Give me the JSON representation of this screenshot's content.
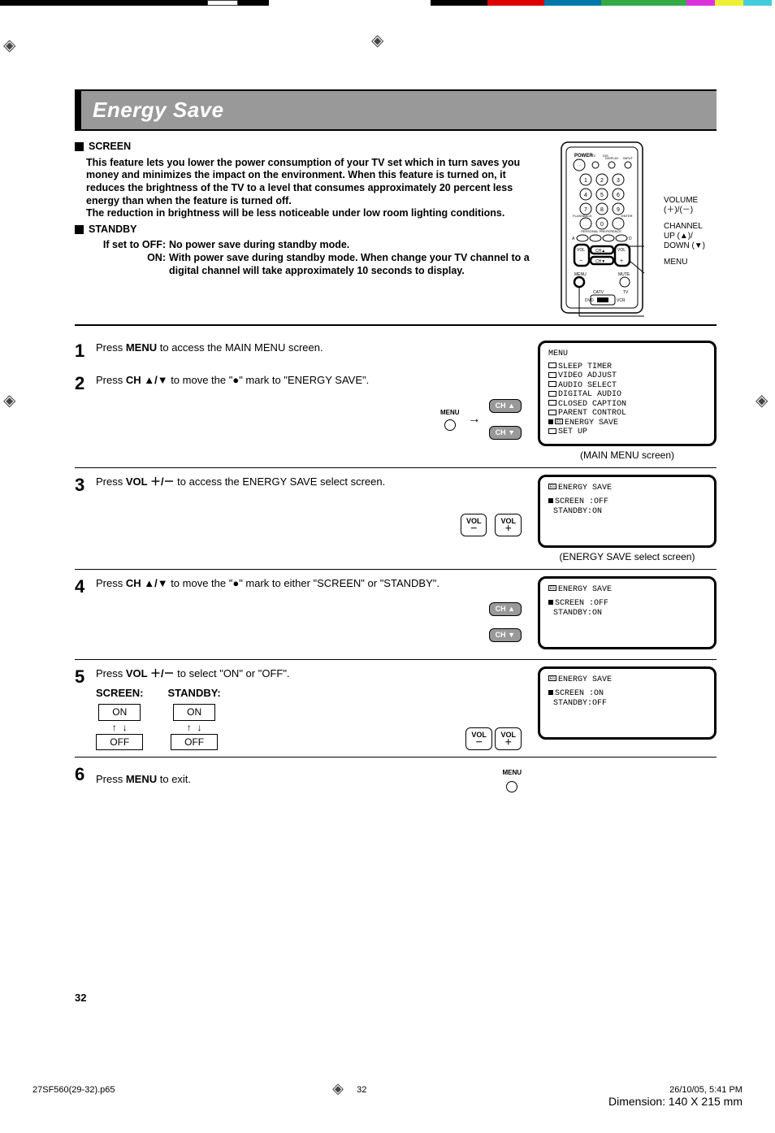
{
  "title": "Energy Save",
  "screen_head": "SCREEN",
  "screen_body": "This feature lets you lower the power consumption of your TV set which in turn saves you money and minimizes the impact on the environment. When this feature is turned on, it reduces the brightness of the TV to a level that consumes approximately 20 percent less energy than when the feature is turned off.\nThe reduction in brightness will be less noticeable under low room lighting conditions.",
  "standby_head": "STANDBY",
  "standby_off": "If set to OFF:",
  "standby_off_body": "No power save during standby mode.",
  "standby_on": "ON:",
  "standby_on_body": "With power save during standby mode. When change your TV channel to a digital channel will take approximately 10 seconds to display.",
  "remote": {
    "volume": "VOLUME\n(＋)/(－)",
    "channel": "CHANNEL\nUP (▲)/\nDOWN (▼)",
    "menu": "MENU"
  },
  "steps": {
    "s1_num": "1",
    "s1_text_a": "Press ",
    "s1_text_b": "MENU",
    "s1_text_c": " to access the MAIN MENU screen.",
    "s2_num": "2",
    "s2_text_a": "Press ",
    "s2_text_b": "CH ▲/▼",
    "s2_text_c": " to move the \"●\" mark to \"ENERGY SAVE\".",
    "s2_key_menu": "MENU",
    "s2_key_cha": "CH ▲",
    "s2_key_chv": "CH ▼",
    "s3_num": "3",
    "s3_text_a": "Press ",
    "s3_text_b": "VOL ＋/－",
    "s3_text_c": "  to access the ENERGY SAVE select screen.",
    "s3_key_volm": "VOL\n－",
    "s3_key_volp": "VOL\n＋",
    "s4_num": "4",
    "s4_text_a": "Press ",
    "s4_text_b": "CH ▲/▼",
    "s4_text_c": " to move the \"●\" mark to either \"SCREEN\" or \"STANDBY\".",
    "s4_key_cha": "CH ▲",
    "s4_key_chv": "CH ▼",
    "s5_num": "5",
    "s5_text_a": "Press ",
    "s5_text_b": "VOL ＋/－",
    "s5_text_c": "  to select \"ON\" or \"OFF\".",
    "s5_screen": "SCREEN:",
    "s5_standby": "STANDBY:",
    "s5_on": "ON",
    "s5_off": "OFF",
    "s5_key_volm": "VOL\n－",
    "s5_key_volp": "VOL\n＋",
    "s6_num": "6",
    "s6_text_a": "Press ",
    "s6_text_b": "MENU",
    "s6_text_c": " to exit.",
    "s6_key_menu": "MENU"
  },
  "osd1": {
    "header": "MENU",
    "lines": [
      "SLEEP TIMER",
      "VIDEO ADJUST",
      "AUDIO SELECT",
      "DIGITAL AUDIO",
      "CLOSED CAPTION",
      "PARENT CONTROL",
      "ENERGY SAVE",
      "SET UP"
    ],
    "caption": "(MAIN MENU screen)"
  },
  "osd2": {
    "header": "ENERGY SAVE",
    "screen": "SCREEN :OFF",
    "standby": " STANDBY:ON",
    "caption": "(ENERGY SAVE select screen)"
  },
  "osd3": {
    "header": "ENERGY SAVE",
    "screen": "SCREEN :OFF",
    "standby": " STANDBY:ON"
  },
  "osd4": {
    "header": "ENERGY SAVE",
    "screen": "SCREEN :ON",
    "standby": " STANDBY:OFF"
  },
  "page_number": "32",
  "footer": {
    "file": "27SF560(29-32).p65",
    "page": "32",
    "date": "26/10/05, 5:41 PM",
    "dim": "Dimension: 140  X 215 mm"
  }
}
